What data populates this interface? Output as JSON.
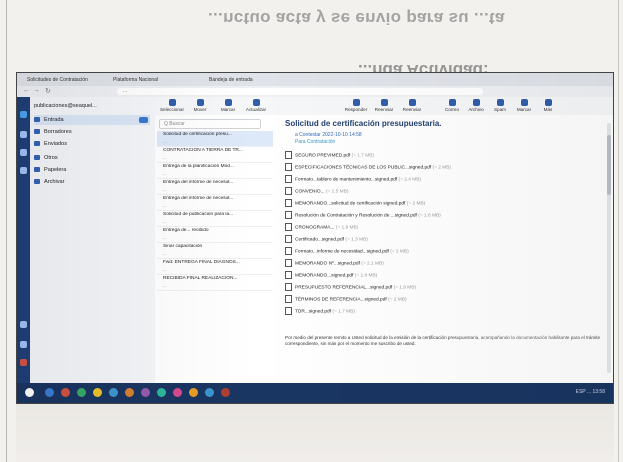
{
  "document": {
    "heading_mirrored": "...nctuo acta y se envio para su ...ta",
    "heading_section": "...nda Actividad:"
  },
  "browser": {
    "tabs": [
      "Solicitudes de Contratación",
      "Plataforma Nacional",
      "Bandeja de entrada"
    ],
    "url": "...",
    "nav_glyphs": [
      "←",
      "→",
      "↻"
    ]
  },
  "folders": {
    "account": "publicaciones@seaquel...",
    "items": [
      {
        "label": "Entrada",
        "selected": true,
        "has_badge": true
      },
      {
        "label": "Borradores",
        "selected": false,
        "has_badge": false
      },
      {
        "label": "Enviados",
        "selected": false,
        "has_badge": false
      },
      {
        "label": "Otros",
        "selected": false,
        "has_badge": false
      },
      {
        "label": "Papelera",
        "selected": false,
        "has_badge": false
      },
      {
        "label": "Archivar",
        "selected": false,
        "has_badge": false
      }
    ]
  },
  "message_list": {
    "search_placeholder": "Q Buscar",
    "messages": [
      {
        "subject": "Solicitud de certificación presu...",
        "meta": "...",
        "selected": true
      },
      {
        "subject": "CONTRATACIÓN A TIERRA DE TR...",
        "meta": "...",
        "selected": false
      },
      {
        "subject": "Entrega de la planificación Mod...",
        "meta": "...",
        "selected": false
      },
      {
        "subject": "Entrega del informe de necesid...",
        "meta": "...",
        "selected": false
      },
      {
        "subject": "Entrega del informe de necesid...",
        "meta": "...",
        "selected": false
      },
      {
        "subject": "Solicitud de publicación para la...",
        "meta": "...",
        "selected": false
      },
      {
        "subject": "Entrega de... recibido",
        "meta": "...",
        "selected": false
      },
      {
        "subject": "Sinar capacitación",
        "meta": "...",
        "selected": false
      },
      {
        "subject": "Fwd: ENTREGA FINAL DIAGNOS...",
        "meta": "...",
        "selected": false
      },
      {
        "subject": "RECIBIDA FINAL REALIZACIÓN...",
        "meta": "...",
        "selected": false
      }
    ]
  },
  "toolbar": {
    "left": [
      {
        "label": "Seleccionar"
      },
      {
        "label": "Mover"
      },
      {
        "label": "Marcar"
      },
      {
        "label": "Actualizar"
      }
    ],
    "right": [
      {
        "label": "Responder"
      },
      {
        "label": "Reenviar"
      },
      {
        "label": "Reenviar"
      },
      {
        "label": "Correo"
      },
      {
        "label": "Archivo"
      },
      {
        "label": "Spam"
      },
      {
        "label": "Marcar"
      },
      {
        "label": "Más"
      }
    ]
  },
  "reading": {
    "subject": "Solicitud de certificación presupuestaria.",
    "from": "a Contestar 2022-10-10 14:58",
    "to": "Para Contratación",
    "attachments": [
      {
        "name": "SEGURO PREVIMED.pdf",
        "size": "(~ 1.7 MB)"
      },
      {
        "name": "ESPECIFICACIONES TÉCNICAS DE LOS PUBLIC...signed.pdf",
        "size": "(~ 2 MB)"
      },
      {
        "name": "Formato...tablero de mantenimiento...signed.pdf",
        "size": "(~ 2.4 MB)"
      },
      {
        "name": "CONVENIO...",
        "size": "(~ 1.5 MB)"
      },
      {
        "name": "MEMORANDO...solicitud de certificación signed.pdf",
        "size": "(~ 2 MB)"
      },
      {
        "name": "Resolución de Contratación y Resolución de ...signed.pdf",
        "size": "(~ 1.6 MB)"
      },
      {
        "name": "CRONOGRAMA...",
        "size": "(~ 1.9 MB)"
      },
      {
        "name": "Certificado...signed.pdf",
        "size": "(~ 1.3 MB)"
      },
      {
        "name": "Formato...informe de necesidad...signed.pdf",
        "size": "(~ 2 MB)"
      },
      {
        "name": "MEMORANDO Nº...signed.pdf",
        "size": "(~ 2.1 MB)"
      },
      {
        "name": "MEMORANDO...signed.pdf",
        "size": "(~ 1.8 MB)"
      },
      {
        "name": "PRESUPUESTO REFERENCIAL...signed.pdf",
        "size": "(~ 1.9 MB)"
      },
      {
        "name": "TÉRMINOS DE REFERENCIA...signed.pdf",
        "size": "(~ 2 MB)"
      },
      {
        "name": "TDR...signed.pdf",
        "size": "(~ 1.7 MB)"
      }
    ],
    "body": "Por medio del presente remito a Usted solicitud de la emisión de la certificación presupuestaria, acompañando la documentación habilitante para el trámite correspondiente, sin más por el momento me suscribo de usted."
  },
  "taskbar": {
    "icons": [
      "#2f7de1",
      "#e74c3c",
      "#27ae60",
      "#f1c40f",
      "#3498db",
      "#e67e22",
      "#9b59b6",
      "#1abc9c",
      "#e84393",
      "#f39c12",
      "#2d98da",
      "#c0392b"
    ],
    "tray": "ESP  ...  13:58"
  },
  "colors": {
    "rail": "#1a3f82",
    "accent": "#2b63c7",
    "taskbar": "#15356a"
  }
}
